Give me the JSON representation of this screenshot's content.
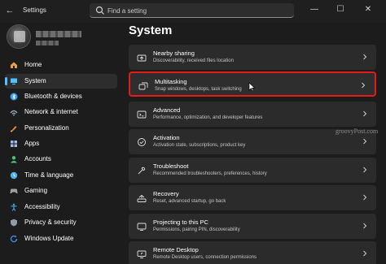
{
  "window": {
    "app_title": "Settings",
    "back_glyph": "←",
    "minimize_glyph": "—",
    "maximize_glyph": "☐",
    "close_glyph": "✕"
  },
  "search": {
    "placeholder": "Find a setting",
    "value": ""
  },
  "sidebar": {
    "items": [
      {
        "label": "Home",
        "icon": "home-icon",
        "color": "#e8a04a"
      },
      {
        "label": "System",
        "icon": "system-icon",
        "color": "#4cc2ff",
        "active": true
      },
      {
        "label": "Bluetooth & devices",
        "icon": "bluetooth-icon",
        "color": "#3a9ae8"
      },
      {
        "label": "Network & internet",
        "icon": "network-icon",
        "color": "#9ab4c8"
      },
      {
        "label": "Personalization",
        "icon": "personalization-icon",
        "color": "#e88a3a"
      },
      {
        "label": "Apps",
        "icon": "apps-icon",
        "color": "#a0b8e8"
      },
      {
        "label": "Accounts",
        "icon": "accounts-icon",
        "color": "#4ac27a"
      },
      {
        "label": "Time & language",
        "icon": "time-language-icon",
        "color": "#4cb0e8"
      },
      {
        "label": "Gaming",
        "icon": "gaming-icon",
        "color": "#a0a0a0"
      },
      {
        "label": "Accessibility",
        "icon": "accessibility-icon",
        "color": "#4ca8e8"
      },
      {
        "label": "Privacy & security",
        "icon": "privacy-shield-icon",
        "color": "#909aa8"
      },
      {
        "label": "Windows Update",
        "icon": "windows-update-icon",
        "color": "#3a8ae8"
      }
    ]
  },
  "main": {
    "title": "System",
    "cards": [
      {
        "title": "Nearby sharing",
        "subtitle": "Discoverability, received files location",
        "icon": "nearby-sharing-icon"
      },
      {
        "title": "Multitasking",
        "subtitle": "Snap windows, desktops, task switching",
        "icon": "multitasking-icon",
        "highlighted": true
      },
      {
        "title": "Advanced",
        "subtitle": "Performance, optimization, and developer features",
        "icon": "advanced-icon"
      },
      {
        "title": "Activation",
        "subtitle": "Activation state, subscriptions, product key",
        "icon": "activation-icon"
      },
      {
        "title": "Troubleshoot",
        "subtitle": "Recommended troubleshooters, preferences, history",
        "icon": "troubleshoot-icon"
      },
      {
        "title": "Recovery",
        "subtitle": "Reset, advanced startup, go back",
        "icon": "recovery-icon"
      },
      {
        "title": "Projecting to this PC",
        "subtitle": "Permissions, pairing PIN, discoverability",
        "icon": "projecting-icon"
      },
      {
        "title": "Remote Desktop",
        "subtitle": "Remote Desktop users, connection permissions",
        "icon": "remote-desktop-icon"
      }
    ]
  },
  "watermark": "groovyPost.com",
  "colors": {
    "accent": "#4cc2ff",
    "highlight_border": "#e31b1b",
    "card_bg": "#2b2b2b",
    "window_bg": "#1c1c1c"
  }
}
